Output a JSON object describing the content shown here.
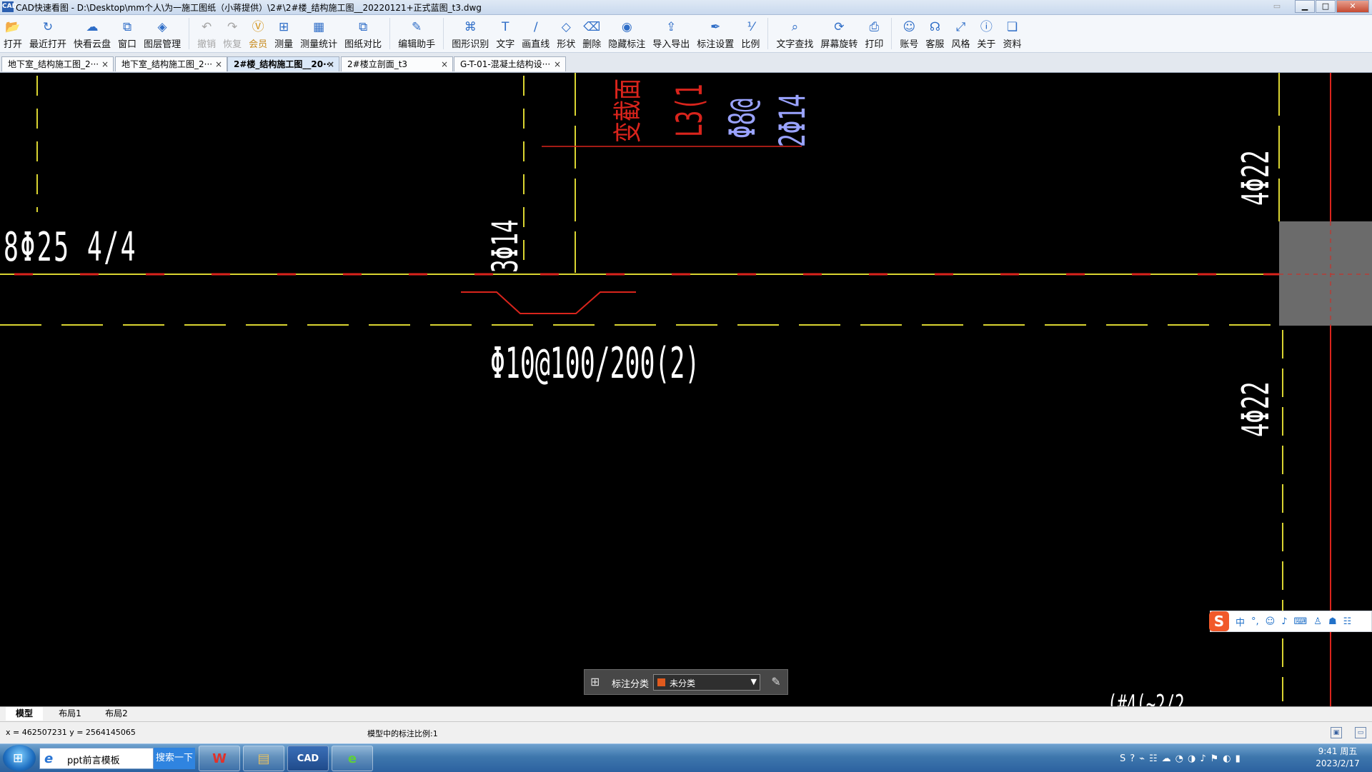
{
  "window": {
    "app_icon": "CAD",
    "title": "CAD快速看图 - D:\\Desktop\\mm个人\\为一施工图纸（小蒋提供）\\2#\\2#楼_结构施工图__20220121+正式蓝图_t3.dwg",
    "minimize": "▁",
    "maximize": "□",
    "close": "✕",
    "extra": "▭"
  },
  "toolbar": {
    "items": [
      {
        "label": "打开",
        "icon": "folder-open-icon",
        "glyph": "📂"
      },
      {
        "label": "最近打开",
        "icon": "history-icon",
        "glyph": "↻"
      },
      {
        "label": "快看云盘",
        "icon": "cloud-icon",
        "glyph": "☁"
      },
      {
        "label": "窗口",
        "icon": "window-icon",
        "glyph": "⧉"
      },
      {
        "label": "图层管理",
        "icon": "layers-icon",
        "glyph": "◈"
      },
      {
        "label": "撤销",
        "icon": "undo-icon",
        "glyph": "↶"
      },
      {
        "label": "恢复",
        "icon": "redo-icon",
        "glyph": "↷"
      },
      {
        "label": "会员",
        "icon": "vip-icon",
        "glyph": "Ⓥ"
      },
      {
        "label": "测量",
        "icon": "measure-icon",
        "glyph": "⊞"
      },
      {
        "label": "测量统计",
        "icon": "measure-stats-icon",
        "glyph": "▦"
      },
      {
        "label": "图纸对比",
        "icon": "compare-icon",
        "glyph": "⧉"
      },
      {
        "label": "编辑助手",
        "icon": "edit-assistant-icon",
        "glyph": "✎"
      },
      {
        "label": "图形识别",
        "icon": "shape-recognize-icon",
        "glyph": "⌘"
      },
      {
        "label": "文字",
        "icon": "text-icon",
        "glyph": "T"
      },
      {
        "label": "画直线",
        "icon": "line-icon",
        "glyph": "∕"
      },
      {
        "label": "形状",
        "icon": "shape-icon",
        "glyph": "◇"
      },
      {
        "label": "删除",
        "icon": "eraser-icon",
        "glyph": "⌫"
      },
      {
        "label": "隐藏标注",
        "icon": "hide-annotation-icon",
        "glyph": "◉"
      },
      {
        "label": "导入导出",
        "icon": "import-export-icon",
        "glyph": "⇪"
      },
      {
        "label": "标注设置",
        "icon": "annotation-settings-icon",
        "glyph": "✒"
      },
      {
        "label": "比例",
        "icon": "scale-icon",
        "glyph": "⅟"
      },
      {
        "label": "文字查找",
        "icon": "text-search-icon",
        "glyph": "⌕"
      },
      {
        "label": "屏幕旋转",
        "icon": "rotate-screen-icon",
        "glyph": "⟳"
      },
      {
        "label": "打印",
        "icon": "print-icon",
        "glyph": "⎙"
      },
      {
        "label": "账号",
        "icon": "account-icon",
        "glyph": "☺"
      },
      {
        "label": "客服",
        "icon": "headset-icon",
        "glyph": "☊"
      },
      {
        "label": "风格",
        "icon": "style-icon",
        "glyph": "⤢"
      },
      {
        "label": "关于",
        "icon": "info-icon",
        "glyph": "ⓘ"
      },
      {
        "label": "资料",
        "icon": "materials-icon",
        "glyph": "❏"
      }
    ]
  },
  "tabs": [
    {
      "label": "地下室_结构施工图_2···",
      "active": false
    },
    {
      "label": "地下室_结构施工图_2···",
      "active": false
    },
    {
      "label": "2#楼_结构施工图__20···",
      "active": true
    },
    {
      "label": "2#楼立剖面_t3",
      "active": false
    },
    {
      "label": "G-T-01-混凝土结构设···",
      "active": false
    }
  ],
  "tab_close": "×",
  "drawing": {
    "texts": {
      "rebar_8_25": "8Φ25 4/4",
      "rebar_3_14": "3Φ14",
      "stirrup": "Φ10@100/200(2)",
      "red_label_1": "变截面",
      "red_label_2": "L3(1",
      "blue_label_1": "Φ8@",
      "blue_label_2": "2Φ14",
      "rebar_4_22_top": "4Φ22",
      "rebar_4_22_bottom": "4Φ22",
      "bottom_partial": "(#4(~2/2"
    },
    "colors": {
      "yellow": "#d9d431",
      "red": "#d9241c",
      "blue": "#9aa3ff",
      "white": "#ffffff",
      "column_fill": "#6b6b6b"
    }
  },
  "annotation_bar": {
    "grid_icon": "⊞",
    "label": "标注分类",
    "value": "未分类",
    "dropdown_arrow": "▼",
    "edit_icon": "✎"
  },
  "ime": {
    "logo": "S",
    "items": [
      "中",
      "°,",
      "☺",
      "♪",
      "⌨",
      "♙",
      "☗",
      "☷"
    ]
  },
  "layout_tabs": [
    "模型",
    "布局1",
    "布局2"
  ],
  "status": {
    "coords": "x = 462507231  y = 2564145065",
    "scale": "模型中的标注比例:1"
  },
  "taskbar": {
    "start": "⊞",
    "search_text": "ppt前言模板",
    "search_button": "搜索一下",
    "apps": [
      {
        "name": "wps",
        "glyph": "W"
      },
      {
        "name": "explorer",
        "glyph": "▤"
      },
      {
        "name": "cad",
        "glyph": "CAD"
      },
      {
        "name": "browser",
        "glyph": "e"
      }
    ],
    "tray": [
      "S",
      "?",
      "⌁",
      "☷",
      "☁",
      "◔",
      "◑",
      "♪",
      "⚑",
      "◐",
      "▮"
    ],
    "time": "9:41 周五",
    "date": "2023/2/17"
  }
}
